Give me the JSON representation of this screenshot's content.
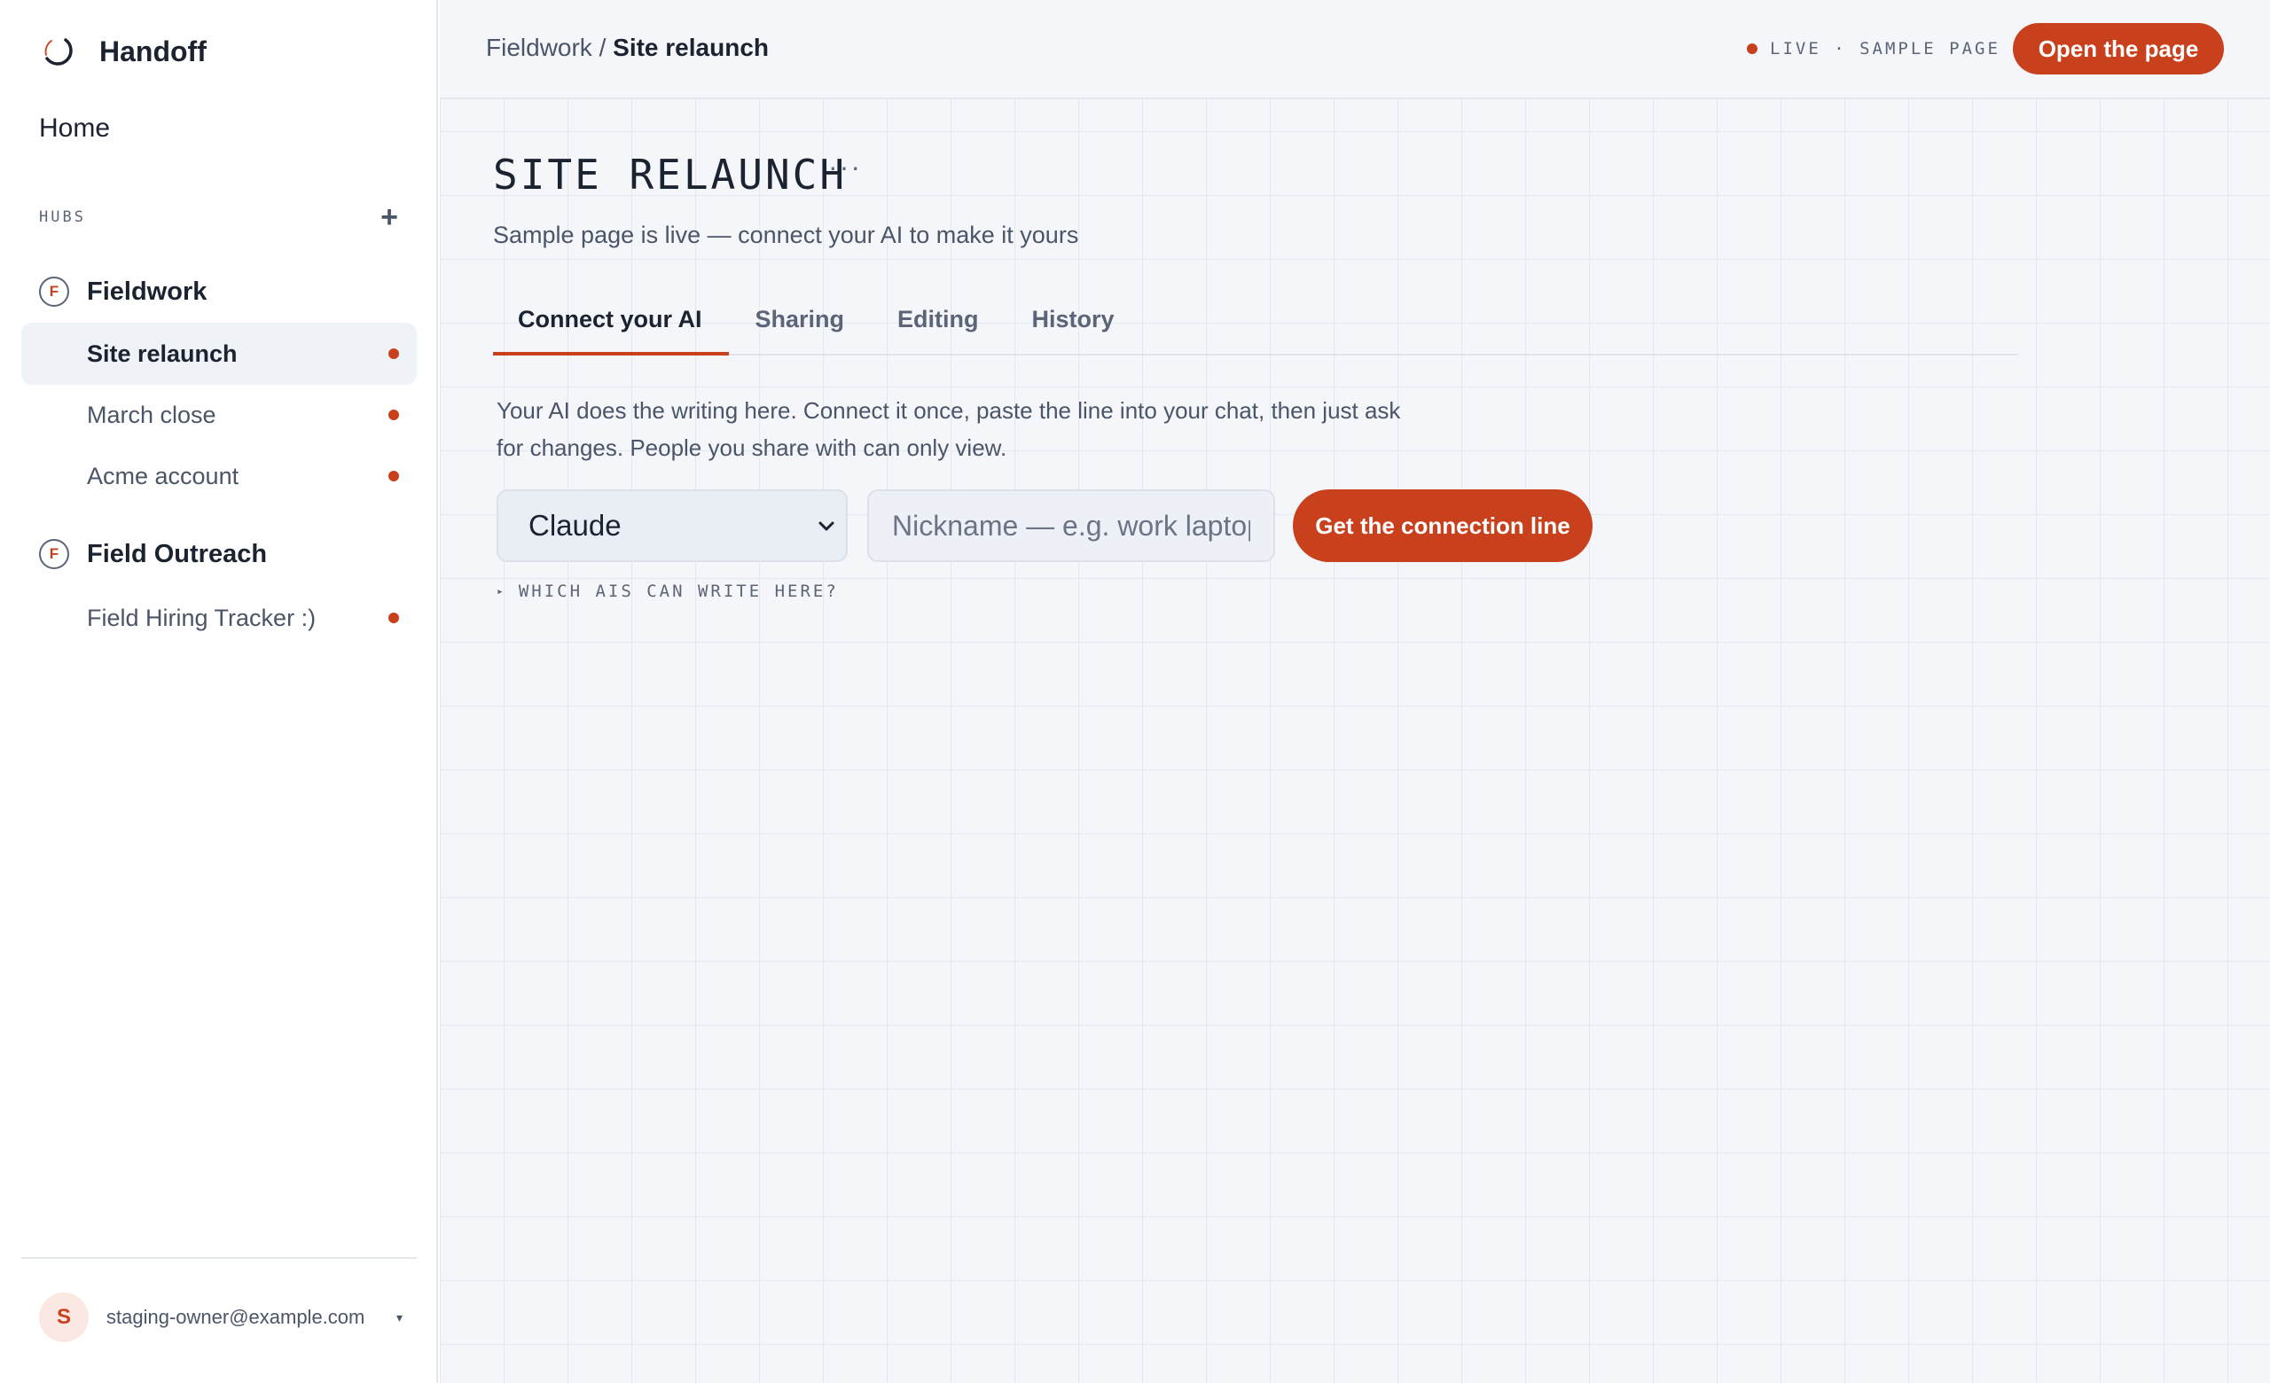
{
  "app": {
    "name": "Handoff"
  },
  "sidebar": {
    "home_label": "Home",
    "hubs_label": "HUBS",
    "add_hub_icon": "+",
    "hubs": [
      {
        "badge": "F",
        "name": "Fieldwork",
        "pages": [
          {
            "label": "Site relaunch",
            "active": true
          },
          {
            "label": "March close",
            "active": false
          },
          {
            "label": "Acme account",
            "active": false
          }
        ]
      },
      {
        "badge": "F",
        "name": "Field Outreach",
        "pages": [
          {
            "label": "Field Hiring Tracker :)",
            "active": false
          }
        ]
      }
    ],
    "account": {
      "avatar_letter": "S",
      "email": "staging-owner@example.com",
      "caret": "▾"
    }
  },
  "topbar": {
    "breadcrumb_parent": "Fieldwork /",
    "breadcrumb_current": "Site relaunch",
    "status_text": "LIVE · SAMPLE PAGE",
    "open_button_label": "Open the page"
  },
  "page": {
    "title": "SITE RELAUNCH",
    "more_icon": "···",
    "subtitle": "Sample page is live — connect your AI to make it yours",
    "tabs": [
      {
        "label": "Connect your AI",
        "active": true
      },
      {
        "label": "Sharing",
        "active": false
      },
      {
        "label": "Editing",
        "active": false
      },
      {
        "label": "History",
        "active": false
      }
    ],
    "intro": "Your AI does the writing here. Connect it once, paste the line into your chat, then just ask for changes. People you share with can only view.",
    "ai_select_value": "Claude",
    "nickname_placeholder": "Nickname — e.g. work laptop",
    "connect_button_label": "Get the connection line",
    "which_ais_icon": "▸",
    "which_ais_label": "WHICH AIS CAN WRITE HERE?"
  },
  "colors": {
    "accent": "#c8401c",
    "background": "#f4f6fa",
    "text": "#1b2230",
    "muted": "#4b5568"
  }
}
